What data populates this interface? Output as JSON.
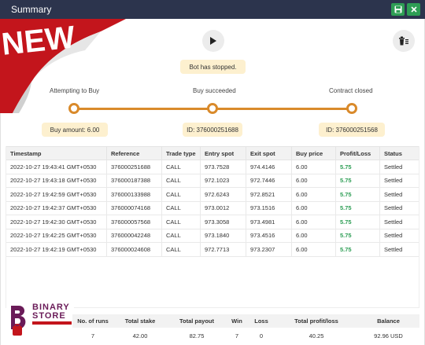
{
  "window": {
    "title": "Summary"
  },
  "banner": {
    "text": "NEW"
  },
  "bot_status": "Bot has stopped.",
  "steps": [
    {
      "label": "Attempting to Buy",
      "info": "Buy amount: 6.00"
    },
    {
      "label": "Buy succeeded",
      "info": "ID: 376000251688"
    },
    {
      "label": "Contract closed",
      "info": "ID: 376000251568"
    }
  ],
  "transactions": {
    "columns": [
      "Timestamp",
      "Reference",
      "Trade type",
      "Entry spot",
      "Exit spot",
      "Buy price",
      "Profit/Loss",
      "Status"
    ],
    "rows": [
      [
        "2022-10-27 19:43:41 GMT+0530",
        "376000251688",
        "CALL",
        "973.7528",
        "974.4146",
        "6.00",
        "5.75",
        "Settled"
      ],
      [
        "2022-10-27 19:43:18 GMT+0530",
        "376000187388",
        "CALL",
        "972.1023",
        "972.7446",
        "6.00",
        "5.75",
        "Settled"
      ],
      [
        "2022-10-27 19:42:59 GMT+0530",
        "376000133988",
        "CALL",
        "972.6243",
        "972.8521",
        "6.00",
        "5.75",
        "Settled"
      ],
      [
        "2022-10-27 19:42:37 GMT+0530",
        "376000074168",
        "CALL",
        "973.0012",
        "973.1516",
        "6.00",
        "5.75",
        "Settled"
      ],
      [
        "2022-10-27 19:42:30 GMT+0530",
        "376000057568",
        "CALL",
        "973.3058",
        "973.4981",
        "6.00",
        "5.75",
        "Settled"
      ],
      [
        "2022-10-27 19:42:25 GMT+0530",
        "376000042248",
        "CALL",
        "973.1840",
        "973.4516",
        "6.00",
        "5.75",
        "Settled"
      ],
      [
        "2022-10-27 19:42:19 GMT+0530",
        "376000024608",
        "CALL",
        "972.7713",
        "973.2307",
        "6.00",
        "5.75",
        "Settled"
      ]
    ]
  },
  "summary": {
    "columns": [
      "No. of runs",
      "Total stake",
      "Total payout",
      "Win",
      "Loss",
      "Total profit/loss",
      "Balance"
    ],
    "values": [
      "7",
      "42.00",
      "82.75",
      "7",
      "0",
      "40.25",
      "92.96 USD"
    ]
  },
  "logo": {
    "line1": "BINARY",
    "line2": "STORE"
  },
  "colors": {
    "titlebar": "#2c344d",
    "accent_green": "#2e9e55",
    "step_orange": "#d98a2b",
    "pill_bg": "#fdf0cf",
    "banner_red": "#c3151c"
  }
}
